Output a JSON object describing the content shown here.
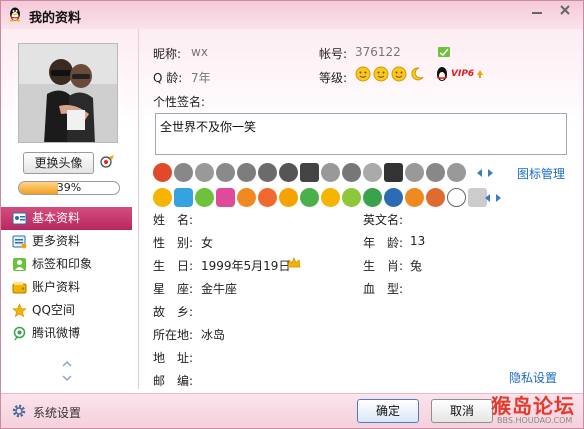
{
  "window": {
    "title": "我的资料"
  },
  "avatar": {
    "change_label": "更换头像",
    "completion": "39%",
    "completion_value": 0.39
  },
  "nav": {
    "items": [
      {
        "label": "基本资料",
        "icon": "id-card-icon",
        "active": true
      },
      {
        "label": "更多资料",
        "icon": "profile-more-icon"
      },
      {
        "label": "标签和印象",
        "icon": "tag-person-icon"
      },
      {
        "label": "账户资料",
        "icon": "wallet-icon"
      },
      {
        "label": "QQ空间",
        "icon": "star-space-icon"
      },
      {
        "label": "腾讯微博",
        "icon": "weibo-icon"
      }
    ]
  },
  "profile": {
    "nickname_label": "昵称:",
    "nickname": "wx",
    "account_label": "帐号:",
    "account": "376122",
    "age_label": "Q 龄:",
    "age": "7年",
    "level_label": "等级:",
    "vip_label": "VIP6",
    "signature_label": "个性签名:",
    "signature": "全世界不及你一笑",
    "icon_manage": "图标管理"
  },
  "details": {
    "name_label": "姓　名:",
    "english_label": "英文名:",
    "gender_label": "性　别:",
    "gender": "女",
    "age_label": "年　龄:",
    "age": "13",
    "birthday_label": "生　日:",
    "birthday": "1999年5月19日",
    "zodiac_label": "生　肖:",
    "zodiac": "兔",
    "star_label": "星　座:",
    "star": "金牛座",
    "blood_label": "血　型:",
    "hometown_label": "故　乡:",
    "location_label": "所在地:",
    "location": "冰岛",
    "address_label": "地　址:",
    "zip_label": "邮　编:",
    "privacy": "隐私设置"
  },
  "footer": {
    "settings": "系统设置",
    "ok": "确定",
    "cancel": "取消",
    "watermark": "猴岛论坛",
    "watermark_sub": "BBS.HOUDAO.COM"
  },
  "colors": {
    "accent": "#c3336a",
    "link": "#1a6cc0",
    "title_bg": "#f6c9d8"
  }
}
